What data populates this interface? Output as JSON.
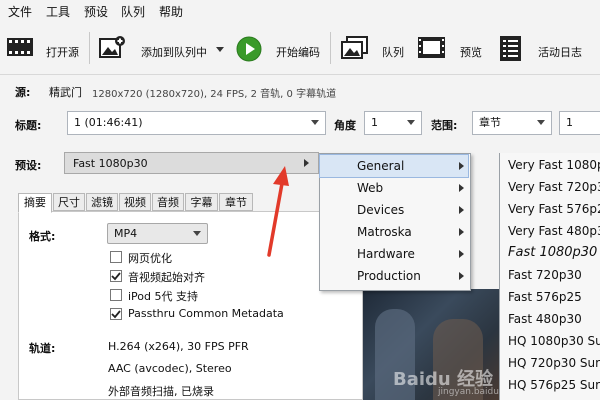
{
  "menubar": [
    "文件",
    "工具",
    "预设",
    "队列",
    "帮助"
  ],
  "toolbar": {
    "open_source": "打开源",
    "add_to_queue": "添加到队列中",
    "start_encode": "开始编码",
    "queue": "队列",
    "preview": "预览",
    "activity_log": "活动日志"
  },
  "source": {
    "label": "源:",
    "name": "精武门",
    "info": "1280x720 (1280x720), 24 FPS, 2 音轨, 0 字幕轨道"
  },
  "title_row": {
    "title_label": "标题:",
    "title_value": "1 (01:46:41)",
    "angle_label": "角度",
    "angle_value": "1",
    "range_label": "范围:",
    "range_type": "章节",
    "range_start": "1"
  },
  "preset": {
    "label": "预设:",
    "value": "Fast 1080p30"
  },
  "tabs": [
    "摘要",
    "尺寸",
    "滤镜",
    "视频",
    "音频",
    "字幕",
    "章节"
  ],
  "summary": {
    "format_label": "格式:",
    "format_value": "MP4",
    "options": [
      {
        "label": "网页优化",
        "checked": false
      },
      {
        "label": "音视频起始对齐",
        "checked": true
      },
      {
        "label": "iPod 5代 支持",
        "checked": false
      },
      {
        "label": "Passthru Common Metadata",
        "checked": true
      }
    ],
    "tracks_label": "轨道:",
    "tracks": [
      "H.264 (x264), 30 FPS PFR",
      "AAC (avcodec), Stereo",
      "外部音频扫描, 已烧录"
    ]
  },
  "preset_menu": {
    "categories": [
      "General",
      "Web",
      "Devices",
      "Matroska",
      "Hardware",
      "Production"
    ],
    "highlighted": "General",
    "submenu": [
      "Very Fast 1080p",
      "Very Fast 720p3",
      "Very Fast 576p2",
      "Very Fast 480p3",
      "Fast 1080p30",
      "Fast 720p30",
      "Fast 576p25",
      "Fast 480p30",
      "HQ 1080p30 Sur",
      "HQ 720p30 Surr",
      "HQ 576p25 Surr"
    ],
    "selected": "Fast 1080p30"
  },
  "watermark": "Baidu 经验",
  "watermark_url": "jingyan.baidu.com",
  "colors": {
    "accent_green": "#3a9a2a",
    "arrow_red": "#e23a2a",
    "menu_highlight": "#d9e6f5"
  }
}
